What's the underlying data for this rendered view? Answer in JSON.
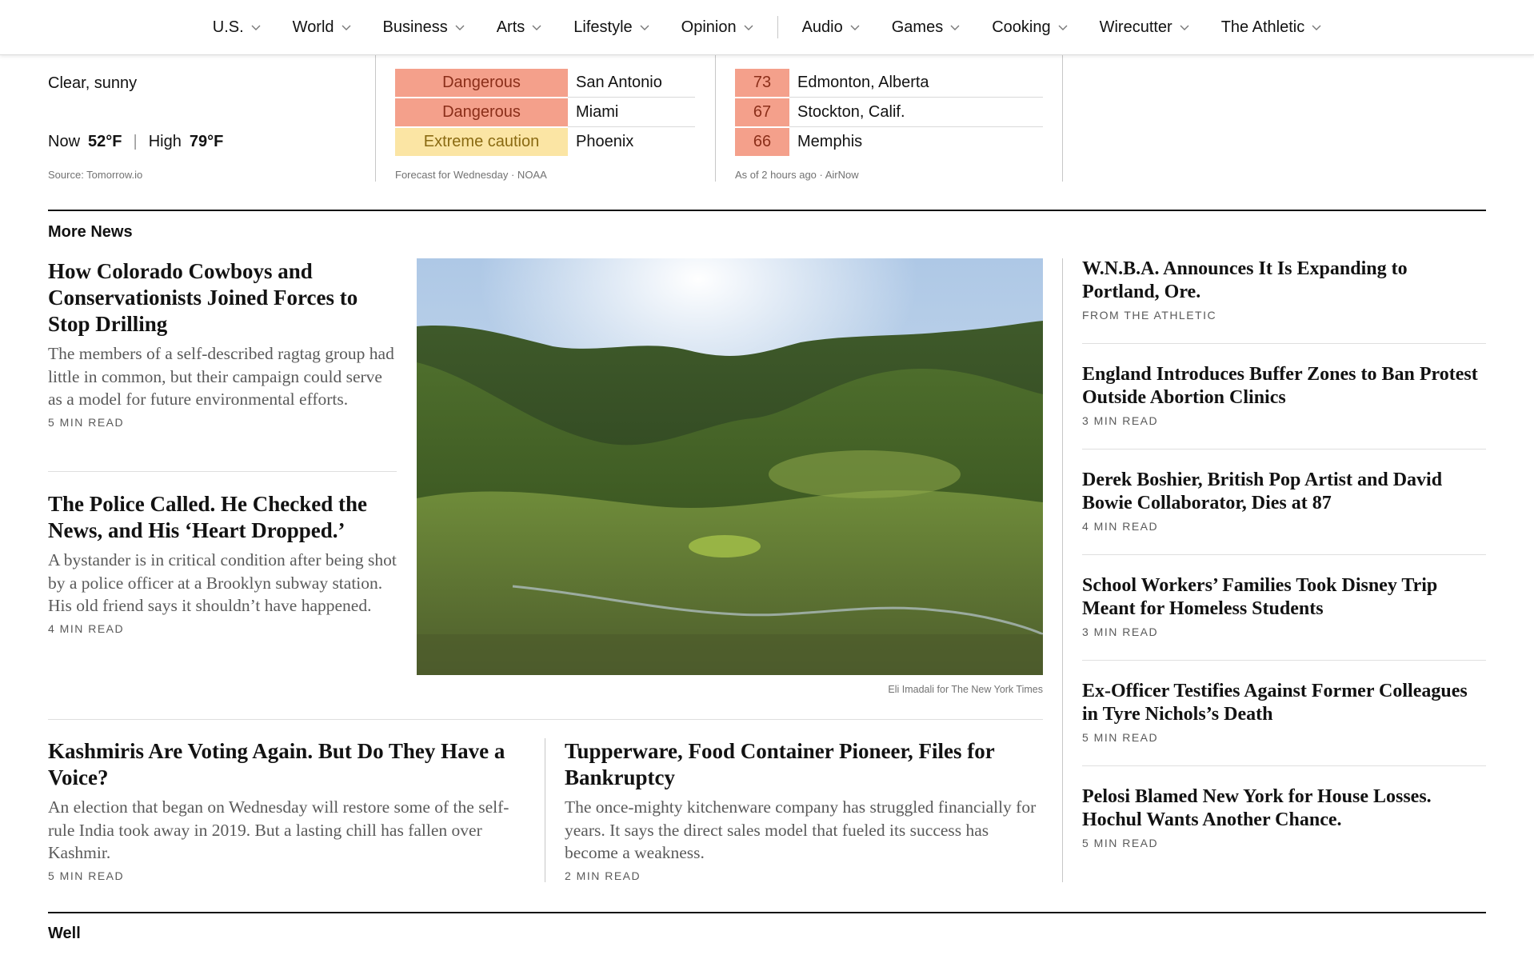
{
  "nav": {
    "items": [
      {
        "label": "U.S."
      },
      {
        "label": "World"
      },
      {
        "label": "Business"
      },
      {
        "label": "Arts"
      },
      {
        "label": "Lifestyle"
      },
      {
        "label": "Opinion"
      },
      {
        "label": "Audio"
      },
      {
        "label": "Games"
      },
      {
        "label": "Cooking"
      },
      {
        "label": "Wirecutter"
      },
      {
        "label": "The Athletic"
      }
    ]
  },
  "weather": {
    "condition": "Clear, sunny",
    "now_label": "Now",
    "now_value": "52°F",
    "high_label": "High",
    "high_value": "79°F",
    "source": "Source: Tomorrow.io"
  },
  "heat": {
    "rows": [
      {
        "level": "Dangerous",
        "city": "San Antonio",
        "color": "#f4a08b"
      },
      {
        "level": "Dangerous",
        "city": "Miami",
        "color": "#f4a08b"
      },
      {
        "level": "Extreme caution",
        "city": "Phoenix",
        "color": "#fbe5a4"
      }
    ],
    "source": "Forecast for Wednesday · NOAA"
  },
  "aqi": {
    "rows": [
      {
        "value": "73",
        "city": "Edmonton, Alberta",
        "color": "#f4a08b"
      },
      {
        "value": "67",
        "city": "Stockton, Calif.",
        "color": "#f4a08b"
      },
      {
        "value": "66",
        "city": "Memphis",
        "color": "#f4a08b"
      }
    ],
    "source": "As of 2 hours ago · AirNow"
  },
  "more_news": {
    "label": "More News",
    "stories": [
      {
        "headline": "How Colorado Cowboys and Conservationists Joined Forces to Stop Drilling",
        "summary": "The members of a self-described ragtag group had little in common, but their campaign could serve as a model for future environmental efforts.",
        "read": "5 MIN READ"
      },
      {
        "headline": "The Police Called. He Checked the News, and His ‘Heart Dropped.’",
        "summary": "A bystander is in critical condition after being shot by a police officer at a Brooklyn subway station. His old friend says it shouldn’t have happened.",
        "read": "4 MIN READ"
      },
      {
        "headline": "Kashmiris Are Voting Again. But Do They Have a Voice?",
        "summary": "An election that began on Wednesday will restore some of the self-rule India took away in 2019. But a lasting chill has fallen over Kashmir.",
        "read": "5 MIN READ"
      },
      {
        "headline": "Tupperware, Food Container Pioneer, Files for Bankruptcy",
        "summary": "The once-mighty kitchenware company has struggled financially for years. It says the direct sales model that fueled its success has become a weakness.",
        "read": "2 MIN READ"
      }
    ],
    "photo_credit": "Eli Imadali for The New York Times",
    "side": [
      {
        "headline": "W.N.B.A. Announces It Is Expanding to Portland, Ore.",
        "label": "FROM THE ATHLETIC"
      },
      {
        "headline": "England Introduces Buffer Zones to Ban Protest Outside Abortion Clinics",
        "label": "3 MIN READ"
      },
      {
        "headline": "Derek Boshier, British Pop Artist and David Bowie Collaborator, Dies at 87",
        "label": "4 MIN READ"
      },
      {
        "headline": "School Workers’ Families Took Disney Trip Meant for Homeless Students",
        "label": "3 MIN READ"
      },
      {
        "headline": "Ex-Officer Testifies Against Former Colleagues in Tyre Nichols’s Death",
        "label": "5 MIN READ"
      },
      {
        "headline": "Pelosi Blamed New York for House Losses. Hochul Wants Another Chance.",
        "label": "5 MIN READ"
      }
    ]
  },
  "well": {
    "label": "Well"
  }
}
